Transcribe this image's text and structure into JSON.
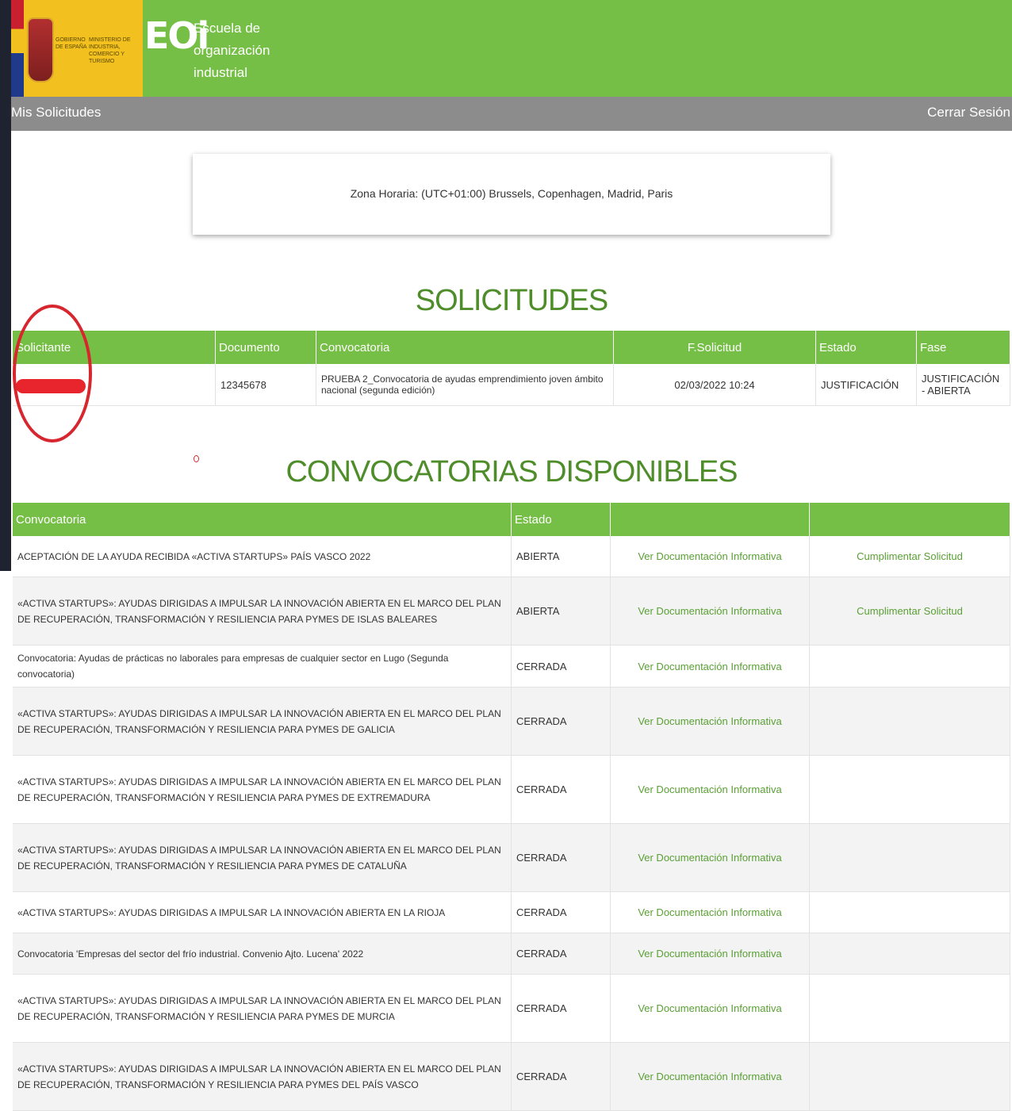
{
  "header": {
    "gov_text": "GOBIERNO DE ESPAÑA",
    "ministry_text": "MINISTERIO DE INDUSTRIA, COMERCIO Y TURISMO",
    "logo_letters": "EOi",
    "logo_text": "Escuela de organización industrial"
  },
  "nav": {
    "left": "Mis Solicitudes",
    "right": "Cerrar Sesión"
  },
  "timezone": "Zona Horaria: (UTC+01:00) Brussels, Copenhagen, Madrid, Paris",
  "solicitudes": {
    "title": "SOLICITUDES",
    "headers": [
      "Solicitante",
      "Documento",
      "Convocatoria",
      "F.Solicitud",
      "Estado",
      "Fase"
    ],
    "rows": [
      [
        "",
        "12345678",
        "PRUEBA 2_Convocatoria de ayudas emprendimiento joven ámbito nacional (segunda edición)",
        "02/03/2022 10:24",
        "JUSTIFICACIÓN",
        "JUSTIFICACIÓN - ABIERTA"
      ]
    ]
  },
  "convocatorias": {
    "title": "CONVOCATORIAS DISPONIBLES",
    "headers": [
      "Convocatoria",
      "Estado",
      "",
      ""
    ],
    "doc_link": "Ver Documentación Informativa",
    "apply_link": "Cumplimentar Solicitud",
    "rows": [
      {
        "name": "ACEPTACIÓN DE LA AYUDA RECIBIDA «ACTIVA STARTUPS» PAÍS VASCO 2022",
        "estado": "ABIERTA"
      },
      {
        "name": "«ACTIVA STARTUPS»: AYUDAS DIRIGIDAS A IMPULSAR LA INNOVACIÓN ABIERTA EN EL MARCO DEL PLAN DE RECUPERACIÓN, TRANSFORMACIÓN Y RESILIENCIA PARA PYMES DE ISLAS BALEARES",
        "estado": "ABIERTA"
      },
      {
        "name": "Convocatoria: Ayudas de prácticas no laborales para empresas de cualquier sector en Lugo (Segunda convocatoria)",
        "estado": "CERRADA"
      },
      {
        "name": "«ACTIVA STARTUPS»: AYUDAS DIRIGIDAS A IMPULSAR LA INNOVACIÓN ABIERTA EN EL MARCO DEL PLAN DE RECUPERACIÓN, TRANSFORMACIÓN Y RESILIENCIA PARA PYMES DE GALICIA",
        "estado": "CERRADA"
      },
      {
        "name": "«ACTIVA STARTUPS»: AYUDAS DIRIGIDAS A IMPULSAR LA INNOVACIÓN ABIERTA EN EL MARCO DEL PLAN DE RECUPERACIÓN, TRANSFORMACIÓN Y RESILIENCIA PARA PYMES DE EXTREMADURA",
        "estado": "CERRADA"
      },
      {
        "name": "«ACTIVA STARTUPS»: AYUDAS DIRIGIDAS A IMPULSAR LA INNOVACIÓN ABIERTA EN EL MARCO DEL PLAN DE RECUPERACIÓN, TRANSFORMACIÓN Y RESILIENCIA PARA PYMES DE CATALUÑA",
        "estado": "CERRADA"
      },
      {
        "name": "«ACTIVA STARTUPS»: AYUDAS DIRIGIDAS A IMPULSAR LA INNOVACIÓN ABIERTA EN LA RIOJA",
        "estado": "CERRADA"
      },
      {
        "name": "Convocatoria 'Empresas del sector del frío industrial. Convenio Ajto. Lucena' 2022",
        "estado": "CERRADA"
      },
      {
        "name": "«ACTIVA STARTUPS»: AYUDAS DIRIGIDAS A IMPULSAR LA INNOVACIÓN ABIERTA EN EL MARCO DEL PLAN DE RECUPERACIÓN, TRANSFORMACIÓN Y RESILIENCIA PARA PYMES DE MURCIA",
        "estado": "CERRADA"
      },
      {
        "name": "«ACTIVA STARTUPS»: AYUDAS DIRIGIDAS A IMPULSAR LA INNOVACIÓN ABIERTA EN EL MARCO DEL PLAN DE RECUPERACIÓN, TRANSFORMACIÓN Y RESILIENCIA PARA PYMES DEL PAÍS VASCO",
        "estado": "CERRADA"
      }
    ]
  }
}
